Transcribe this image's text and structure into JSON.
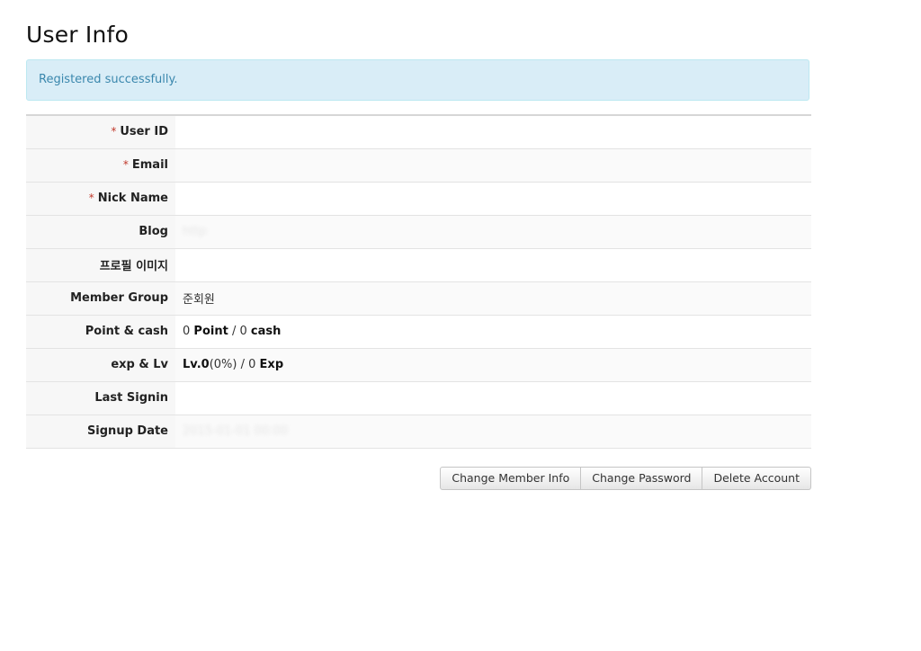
{
  "page": {
    "title": "User Info"
  },
  "alert": {
    "message": "Registered successfully."
  },
  "required_mark": "*",
  "fields": {
    "user_id": {
      "label": "User ID",
      "value": ""
    },
    "email": {
      "label": "Email",
      "value": ""
    },
    "nick_name": {
      "label": "Nick Name",
      "value": ""
    },
    "blog": {
      "label": "Blog",
      "value": "http"
    },
    "profile_image": {
      "label": "프로필 이미지",
      "value": ""
    },
    "member_group": {
      "label": "Member Group",
      "value": "준회원"
    },
    "point_cash": {
      "label": "Point & cash",
      "point_value": "0",
      "point_unit": "Point",
      "separator": " / ",
      "cash_value": "0",
      "cash_unit": "cash"
    },
    "exp_lv": {
      "label": "exp & Lv",
      "level": "Lv.0",
      "percent": "(0%)",
      "separator": " / ",
      "exp_value": "0",
      "exp_unit": "Exp"
    },
    "last_signin": {
      "label": "Last Signin",
      "value": ""
    },
    "signup_date": {
      "label": "Signup Date",
      "value": "2015-01-01 00:00"
    }
  },
  "buttons": {
    "change_member_info": "Change Member Info",
    "change_password": "Change Password",
    "delete_account": "Delete Account"
  }
}
